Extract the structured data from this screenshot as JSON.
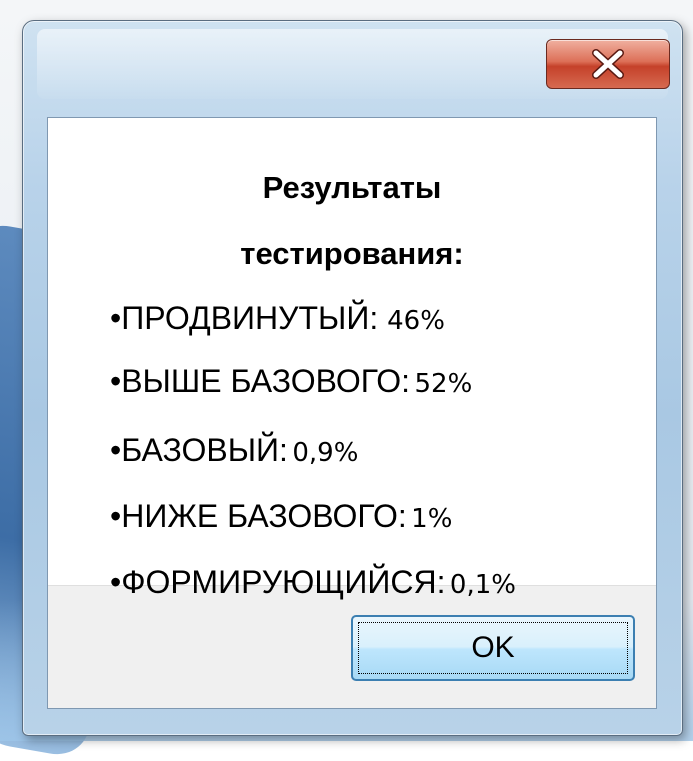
{
  "dialog": {
    "title_line_1": "Результаты",
    "title_line_2": "тестирования:",
    "close_icon": "close-x-icon",
    "ok_label": "OK"
  },
  "results": [
    {
      "bullet": "•",
      "level": "ПРОДВИНУТЫЙ:",
      "value": "46%"
    },
    {
      "bullet": "•",
      "level": "ВЫШЕ БАЗОВОГО:",
      "value": "52%"
    },
    {
      "bullet": "•",
      "level": "БАЗОВЫЙ:",
      "value": "0,9%"
    },
    {
      "bullet": "•",
      "level": "НИЖЕ БАЗОВОГО:",
      "value": "1%"
    },
    {
      "bullet": "•",
      "level": "ФОРМИРУЮЩИЙСЯ:",
      "value": "0,1%"
    }
  ],
  "colors": {
    "close_button": "#c5412a",
    "ok_border": "#3c7fb1",
    "window_frame": "#a9c8e3"
  }
}
